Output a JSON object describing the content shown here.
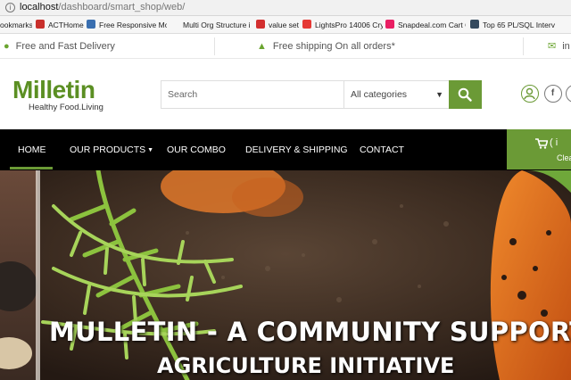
{
  "browser": {
    "url_host": "localhost",
    "url_path": "/dashboard/smart_shop/web/"
  },
  "bookmarks": [
    {
      "label": "ookmarks",
      "icon": "none"
    },
    {
      "label": "ACTHome",
      "icon": "acthome-favicon"
    },
    {
      "label": "Free Responsive Mo",
      "icon": "w3-favicon"
    },
    {
      "label": "Multi Org Structure i",
      "icon": "none"
    },
    {
      "label": "value set",
      "icon": "oracle-favicon"
    },
    {
      "label": "LightsPro 14006 Crys",
      "icon": "pf-favicon"
    },
    {
      "label": "Snapdeal.com Cart C",
      "icon": "sd-favicon"
    },
    {
      "label": "Top 65 PL/SQL Interv",
      "icon": "g-favicon"
    }
  ],
  "promo": {
    "delivery": "Free and Fast Delivery",
    "shipping": "Free shipping On all orders*",
    "email_fragment": "in"
  },
  "header": {
    "logo_text": "Milletin",
    "logo_tagline": "Healthy Food.Living",
    "search_placeholder": "Search",
    "category_selected": "All categories",
    "social_fb": "f"
  },
  "nav": {
    "items": [
      "HOME",
      "OUR PRODUCTS",
      "OUR COMBO",
      "DELIVERY & SHIPPING",
      "CONTACT"
    ],
    "active_index": 0,
    "cart_line1": "( i",
    "cart_line2": "Clea"
  },
  "hero": {
    "headline_line1": "MULLETIN - A COMMUNITY SUPPORTED",
    "headline_line2": "AGRICULTURE INITIATIVE"
  },
  "colors": {
    "brand_green": "#6b9a36",
    "nav_background": "#000000"
  }
}
